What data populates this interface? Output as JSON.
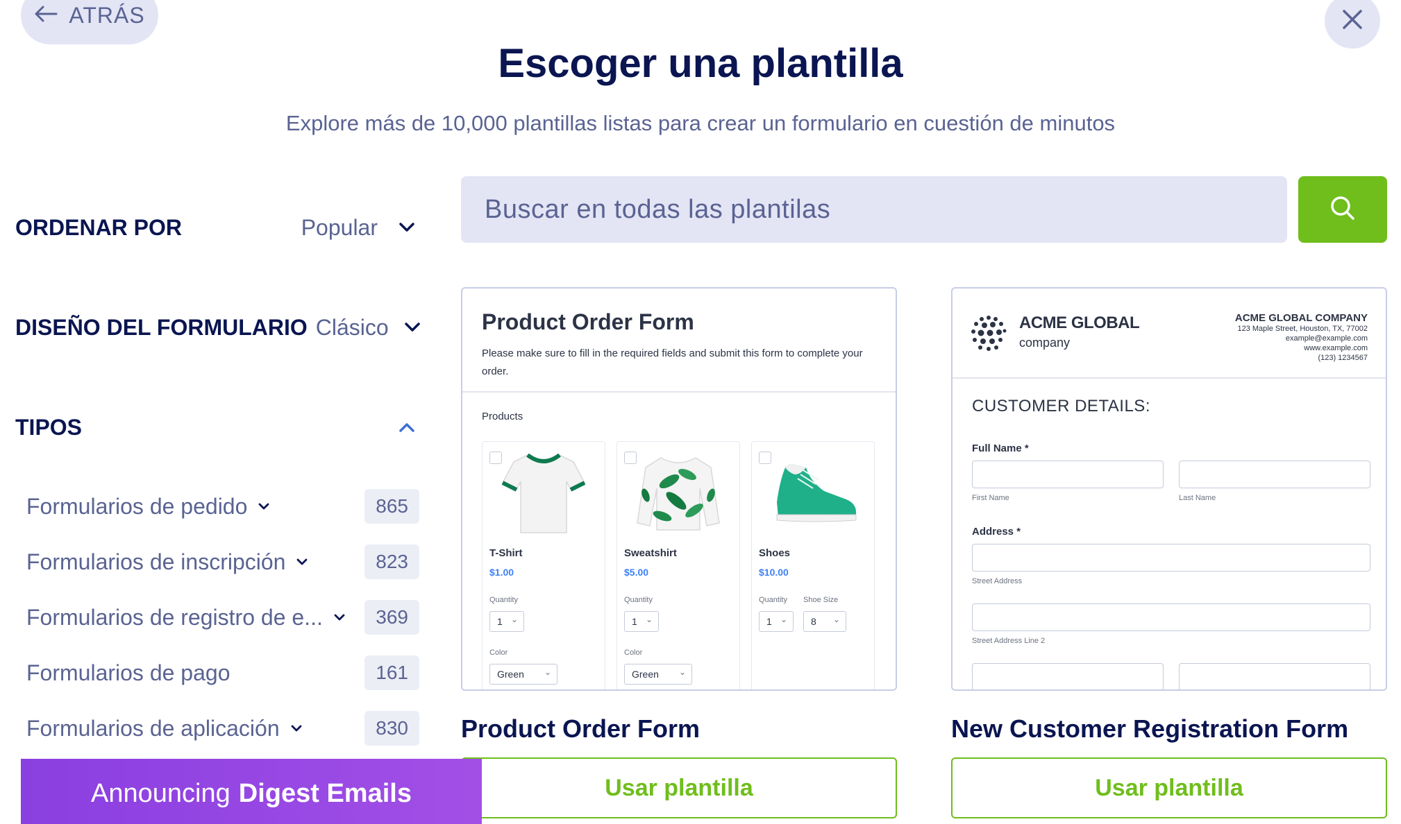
{
  "header": {
    "back_label": "ATRÁS",
    "title": "Escoger una plantilla",
    "subtitle": "Explore más de 10,000 plantillas listas para crear un formulario en cuestión de minutos"
  },
  "sidebar": {
    "sort": {
      "label": "ORDENAR POR",
      "value": "Popular"
    },
    "design": {
      "label": "DISEÑO DEL FORMULARIO",
      "value": "Clásico"
    },
    "types": {
      "label": "TIPOS",
      "items": [
        {
          "label": "Formularios de pedido",
          "count": "865",
          "has_children": true
        },
        {
          "label": "Formularios de inscripción",
          "count": "823",
          "has_children": true
        },
        {
          "label": "Formularios de registro de e...",
          "count": "369",
          "has_children": true
        },
        {
          "label": "Formularios de pago",
          "count": "161",
          "has_children": false
        },
        {
          "label": "Formularios de aplicación",
          "count": "830",
          "has_children": true
        }
      ]
    }
  },
  "search": {
    "placeholder": "Buscar en todas las plantilas"
  },
  "templates": [
    {
      "title": "Product Order Form",
      "button": "Usar plantilla",
      "preview": {
        "title": "Product Order Form",
        "description": "Please make sure to fill in the required fields and submit this form to complete your order.",
        "products_label": "Products",
        "products": [
          {
            "name": "T-Shirt",
            "price": "$1.00",
            "quantity_label": "Quantity",
            "quantity": "1",
            "color_label": "Color",
            "color": "Green"
          },
          {
            "name": "Sweatshirt",
            "price": "$5.00",
            "quantity_label": "Quantity",
            "quantity": "1",
            "color_label": "Color",
            "color": "Green"
          },
          {
            "name": "Shoes",
            "price": "$10.00",
            "quantity_label": "Quantity",
            "quantity": "1",
            "size_label": "Shoe Size",
            "size": "8"
          }
        ]
      }
    },
    {
      "title": "New Customer Registration Form",
      "button": "Usar plantilla",
      "preview": {
        "logo_line1": "ACME GLOBAL",
        "logo_line2": "company",
        "company_name": "ACME GLOBAL COMPANY",
        "company_address": "123 Maple Street, Houston, TX, 77002",
        "company_email": "example@example.com",
        "company_web": "www.example.com",
        "company_phone": "(123) 1234567",
        "section": "CUSTOMER DETAILS:",
        "full_name_label": "Full Name",
        "first_name": "First Name",
        "last_name": "Last Name",
        "address_label": "Address",
        "street_address": "Street Address",
        "street_address_2": "Street Address Line 2"
      }
    }
  ],
  "announcement": {
    "prefix": "Announcing",
    "highlight": "Digest Emails"
  },
  "colors": {
    "navy": "#0a1551",
    "muted": "#5a6392",
    "green": "#6fbe1c",
    "lavender": "#e3e5f5",
    "purple": "#8a3fe0"
  }
}
